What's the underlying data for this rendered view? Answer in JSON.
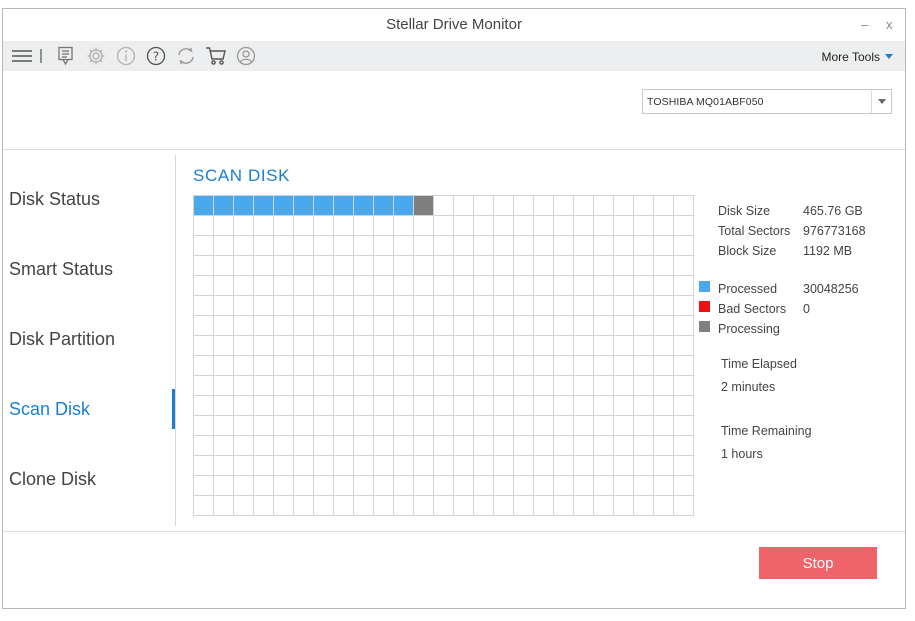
{
  "window": {
    "title": "Stellar Drive Monitor",
    "minimize_label": "–",
    "close_label": "x"
  },
  "toolbar": {
    "icons": [
      "menu-icon",
      "report-icon",
      "settings-icon",
      "info-icon",
      "help-icon",
      "refresh-icon",
      "cart-icon",
      "account-icon"
    ],
    "more_tools_label": "More Tools"
  },
  "disk_selector": {
    "selected": "TOSHIBA MQ01ABF050"
  },
  "sidebar": {
    "items": [
      {
        "label": "Disk Status",
        "active": false
      },
      {
        "label": "Smart Status",
        "active": false
      },
      {
        "label": "Disk Partition",
        "active": false
      },
      {
        "label": "Scan Disk",
        "active": true
      },
      {
        "label": "Clone Disk",
        "active": false
      }
    ]
  },
  "scan": {
    "title": "SCAN DISK",
    "grid": {
      "columns": 25,
      "rows": 16,
      "processed_blocks": 11,
      "processing_blocks": 1
    },
    "info": {
      "disk_size_label": "Disk Size",
      "disk_size_value": "465.76 GB",
      "total_sectors_label": "Total Sectors",
      "total_sectors_value": "976773168",
      "block_size_label": "Block Size",
      "block_size_value": "1192 MB"
    },
    "legend": {
      "processed_label": "Processed",
      "processed_value": "30048256",
      "processed_color": "#4aa8ec",
      "bad_label": "Bad Sectors",
      "bad_value": "0",
      "bad_color": "#ee1111",
      "processing_label": "Processing",
      "processing_color": "#7f7f7f"
    },
    "time_elapsed_label": "Time Elapsed",
    "time_elapsed_value": "2 minutes",
    "time_remaining_label": "Time Remaining",
    "time_remaining_value": "1 hours"
  },
  "footer": {
    "stop_label": "Stop"
  }
}
